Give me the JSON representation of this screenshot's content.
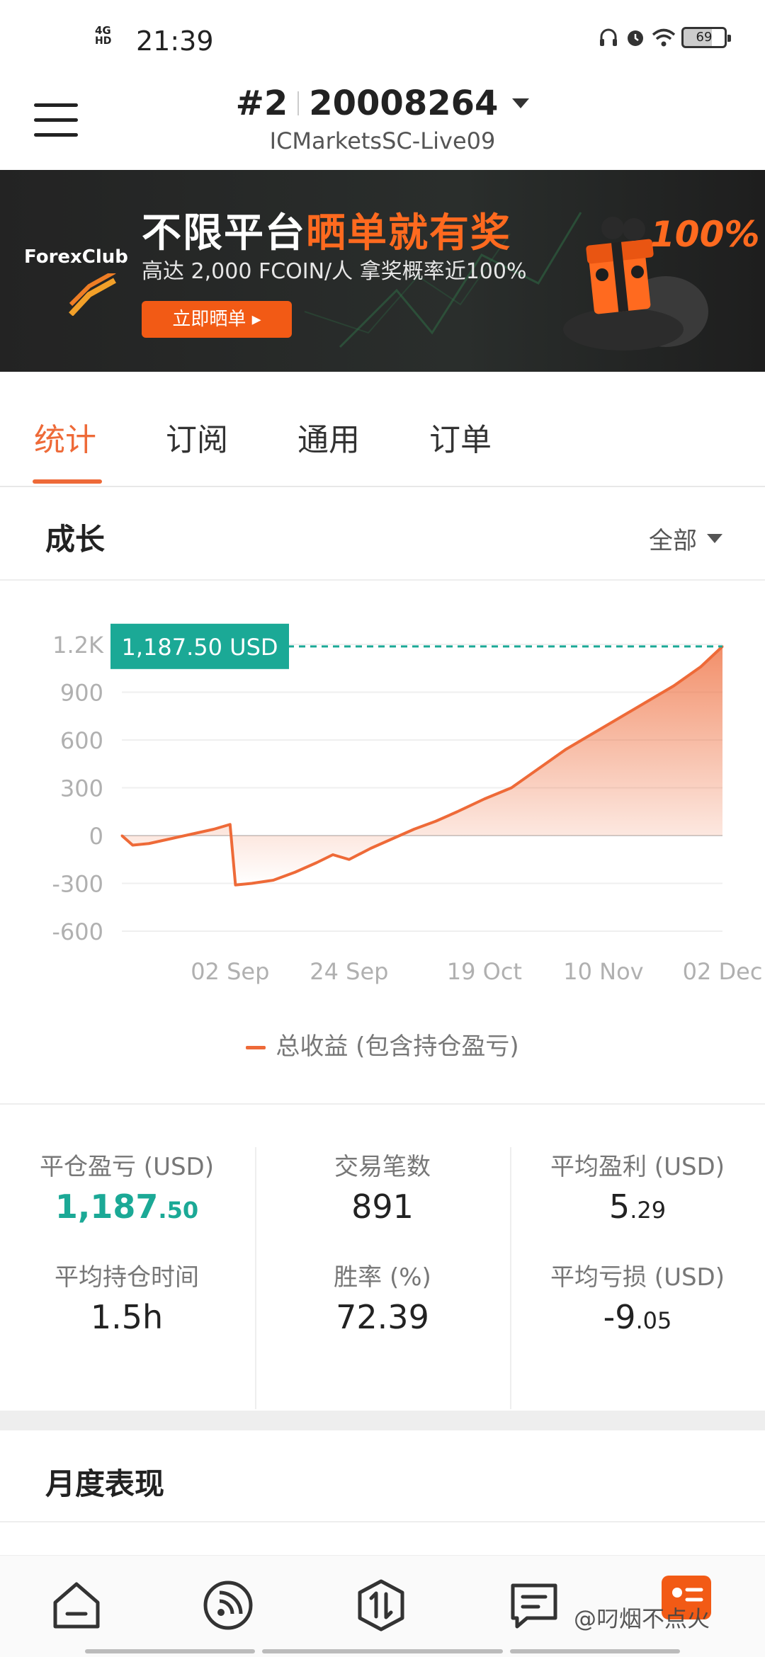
{
  "status_bar": {
    "network": "4G",
    "network_sub": "HD",
    "time": "21:39",
    "battery": "69"
  },
  "header": {
    "account_index": "#2",
    "account_number": "20008264",
    "server": "ICMarketsSC-Live09"
  },
  "banner": {
    "brand": "ForexClub",
    "title_plain": "不限平台",
    "title_accent": "晒单就有奖",
    "subtitle": "高达 2,000 FCOIN/人  拿奖概率近100%",
    "cta": "立即晒单 ▸",
    "percent": "100%"
  },
  "tabs": [
    {
      "label": "统计"
    },
    {
      "label": "订阅"
    },
    {
      "label": "通用"
    },
    {
      "label": "订单"
    }
  ],
  "growth": {
    "title": "成长",
    "range_label": "全部",
    "current_badge": "1,187.50 USD",
    "legend": "总收益 (包含持仓盈亏)"
  },
  "chart_data": {
    "type": "area",
    "series": [
      {
        "name": "总收益 (包含持仓盈亏)",
        "color": "#ee6a38"
      }
    ],
    "x": [
      "2024-08-13",
      "2024-08-15",
      "2024-08-18",
      "2024-08-22",
      "2024-08-26",
      "2024-08-30",
      "2024-09-02",
      "2024-09-03",
      "2024-09-06",
      "2024-09-10",
      "2024-09-14",
      "2024-09-18",
      "2024-09-21",
      "2024-09-24",
      "2024-09-28",
      "2024-10-02",
      "2024-10-06",
      "2024-10-10",
      "2024-10-14",
      "2024-10-19",
      "2024-10-24",
      "2024-10-29",
      "2024-11-03",
      "2024-11-08",
      "2024-11-13",
      "2024-11-18",
      "2024-11-23",
      "2024-11-28",
      "2024-12-02"
    ],
    "values": [
      0,
      -60,
      -50,
      -20,
      10,
      40,
      70,
      -310,
      -300,
      -280,
      -230,
      -170,
      -120,
      -150,
      -80,
      -20,
      40,
      90,
      150,
      230,
      300,
      420,
      540,
      640,
      740,
      840,
      940,
      1060,
      1187.5
    ],
    "x_tick_labels": [
      "02 Sep",
      "24 Sep",
      "19 Oct",
      "10 Nov",
      "02 Dec"
    ],
    "x_tick_values": [
      "2024-09-02",
      "2024-09-24",
      "2024-10-19",
      "2024-11-10",
      "2024-12-02"
    ],
    "y_tick_labels": [
      "1.2K",
      "900",
      "600",
      "300",
      "0",
      "-300",
      "-600"
    ],
    "y_tick_values": [
      1200,
      900,
      600,
      300,
      0,
      -300,
      -600
    ],
    "ylim": [
      -600,
      1200
    ],
    "grid": true,
    "last_value_label": "1,187.50 USD"
  },
  "stats": [
    [
      {
        "label": "平仓盈亏 (USD)",
        "int": "1,187",
        "dec": ".50",
        "highlight": true
      },
      {
        "label": "平均持仓时间",
        "int": "1.5h",
        "dec": ""
      }
    ],
    [
      {
        "label": "交易笔数",
        "int": "891",
        "dec": ""
      },
      {
        "label": "胜率 (%)",
        "int": "72.39",
        "dec": ""
      }
    ],
    [
      {
        "label": "平均盈利 (USD)",
        "int": "5",
        "dec": ".29"
      },
      {
        "label": "平均亏损 (USD)",
        "int": "-9",
        "dec": ".05"
      }
    ]
  ],
  "monthly": {
    "title": "月度表现"
  },
  "bottom_nav": {
    "watermark": "@叼烟不点火",
    "badge_color": "#f25a15"
  }
}
